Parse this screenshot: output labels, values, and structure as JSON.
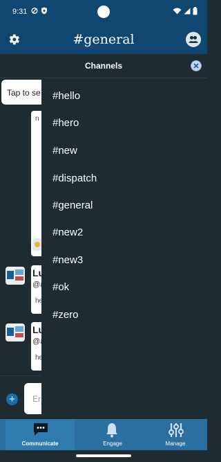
{
  "status_bar": {
    "time": "9:31"
  },
  "app_bar": {
    "title": "#general",
    "settings_icon": "gear-icon",
    "profile_icon": "people-icon"
  },
  "chat": {
    "search_hint": "Tap to se",
    "messages": [
      {
        "name": "Lu",
        "handle": "@a",
        "text": "he"
      },
      {
        "name": "Lu",
        "handle": "@a",
        "text": "he"
      }
    ],
    "top_snippet": "n",
    "compose_placeholder": "Er"
  },
  "drawer": {
    "title": "Channels",
    "channels": [
      "#hello",
      "#hero",
      "#new",
      "#dispatch",
      "#general",
      "#new2",
      "#new3",
      "#ok",
      "#zero"
    ]
  },
  "bottom_nav": {
    "items": [
      {
        "label": "Communicate",
        "icon": "chat-icon",
        "active": true
      },
      {
        "label": "Engage",
        "icon": "bell-icon",
        "active": false
      },
      {
        "label": "Manage",
        "icon": "sliders-icon",
        "active": false
      }
    ]
  },
  "colors": {
    "app_bar": "#0f4770",
    "dark_bg": "#1e2b31",
    "nav_bar": "#2a6f9f",
    "accent": "#1b6ea8"
  }
}
